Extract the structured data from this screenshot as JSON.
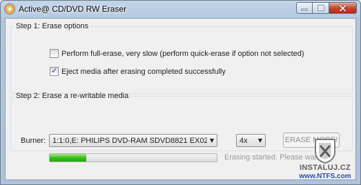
{
  "window": {
    "title": "Active@ CD/DVD RW Eraser",
    "app_icon": "cd-disc-icon",
    "caption_buttons": [
      "minimize-icon",
      "maximize-icon",
      "close-icon"
    ]
  },
  "step1": {
    "title": "Step 1: Erase options",
    "options": [
      {
        "label": "Perform full-erase, very slow (perform quick-erase if option not selected)",
        "checked": false
      },
      {
        "label": "Eject media after erasing completed successfully",
        "checked": true
      }
    ]
  },
  "step2": {
    "title": "Step 2: Erase a re-writable media",
    "burner_label": "Burner:",
    "burner_value": "1:1:0,E: PHILIPS  DVD-RAM SDVD8821 EX02",
    "speed_value": "4x",
    "erase_button": "ERASE MORE!",
    "erase_enabled": false,
    "progress_fraction": 0.22,
    "status": "Erasing started. Please wait..."
  },
  "watermark": {
    "line1": "INSTALUJ.CZ",
    "line2": "www.NTFS.com",
    "icon": "crest-logo-icon"
  },
  "colors": {
    "progress": "#37c21b",
    "title_bar": "#b2c7df",
    "watermark_link": "#2a4fa8"
  }
}
